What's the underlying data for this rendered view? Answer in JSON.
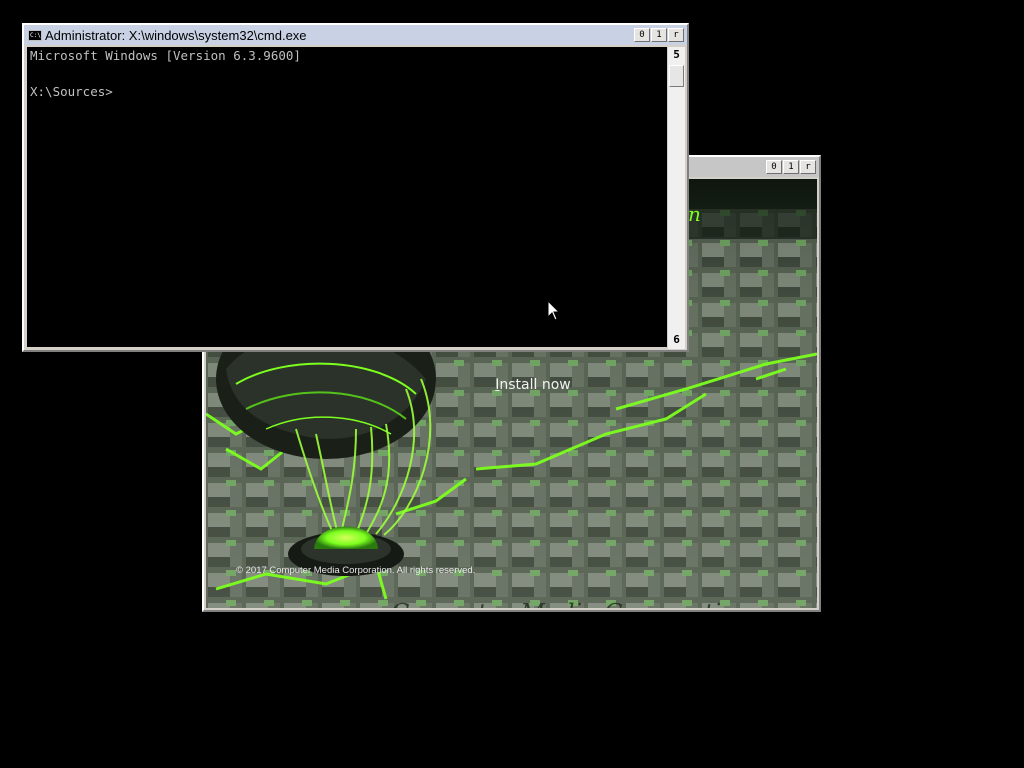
{
  "cmd_window": {
    "title": "Administrator: X:\\windows\\system32\\cmd.exe",
    "icon": "cmd-icon",
    "icon_text": "C:\\",
    "buttons": {
      "minimize": "0",
      "maximize": "1",
      "close": "r"
    },
    "lines": [
      "Microsoft Windows [Version 6.3.9600]",
      "",
      "X:\\Sources>"
    ],
    "scroll_up_glyph": "5",
    "scroll_down_glyph": "6"
  },
  "setup_window": {
    "buttons": {
      "minimize": "0",
      "maximize": "1",
      "close": "r"
    },
    "install_button_first": "I",
    "install_button_rest": "nstall now",
    "copyright": "© 2017 Computer Media Corporation. All rights reserved.",
    "accent_color": "#7cff1e"
  }
}
